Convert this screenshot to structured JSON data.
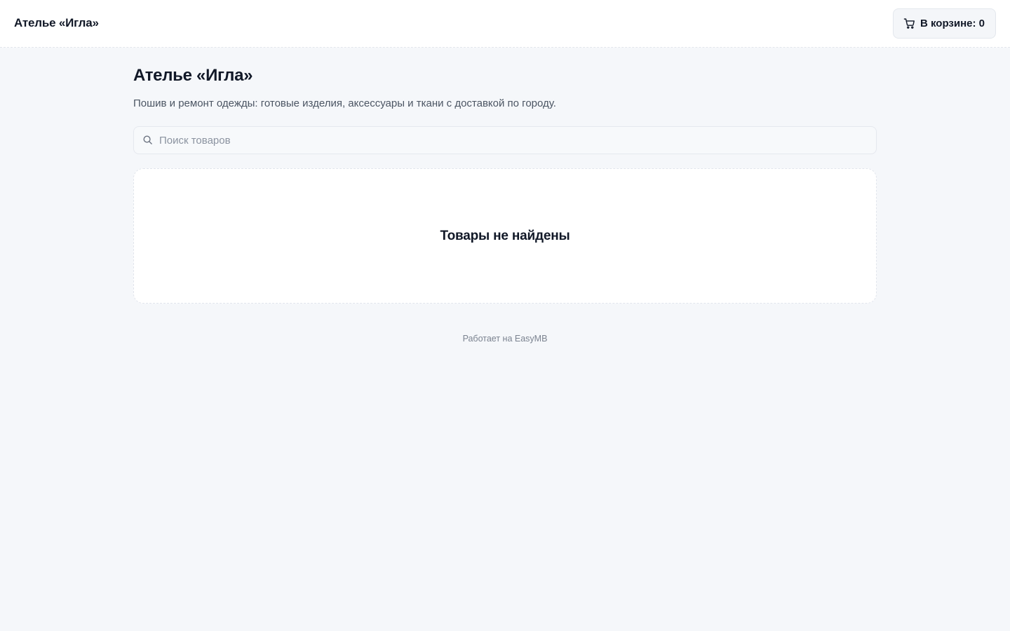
{
  "header": {
    "brand": "Ателье «Игла»",
    "cart_label": "В корзине: 0",
    "cart_icon": "cart-icon"
  },
  "main": {
    "title": "Ателье «Игла»",
    "subtitle": "Пошив и ремонт одежды: готовые изделия, аксессуары и ткани с доставкой по городу.",
    "search": {
      "placeholder": "Поиск товаров",
      "value": "",
      "icon": "search-icon"
    },
    "empty_state": "Товары не найдены"
  },
  "footer": {
    "powered_by": "Работает на EasyMB"
  },
  "colors": {
    "background": "#f5f7fa",
    "surface": "#ffffff",
    "text": "#111827",
    "muted": "#4b5563"
  }
}
